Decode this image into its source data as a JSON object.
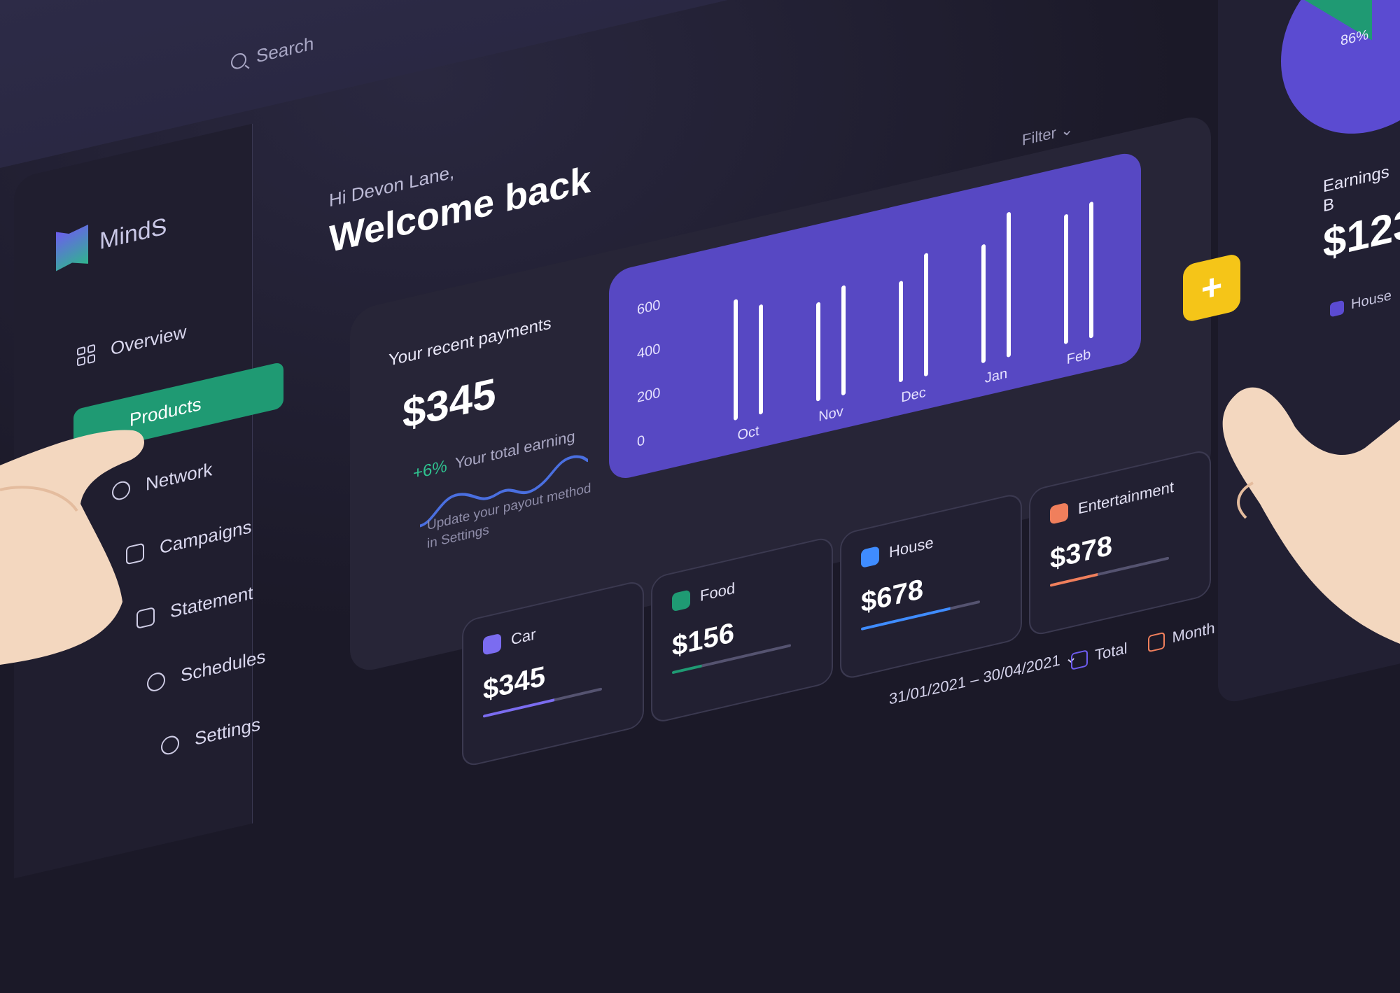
{
  "search": {
    "label": "Search"
  },
  "brand": {
    "name": "MindS"
  },
  "nav": [
    {
      "label": "Overview",
      "icon": "grid-icon"
    },
    {
      "label": "Products",
      "icon": "box-icon",
      "active": true
    },
    {
      "label": "Network",
      "icon": "users-icon"
    },
    {
      "label": "Campaigns",
      "icon": "chart-icon"
    },
    {
      "label": "Statement",
      "icon": "document-icon"
    },
    {
      "label": "Schedules",
      "icon": "compass-icon"
    },
    {
      "label": "Settings",
      "icon": "gear-icon"
    }
  ],
  "greeting": {
    "hi": "Hi Devon Lane,",
    "title": "Welcome back"
  },
  "payments": {
    "label": "Your recent payments",
    "value": "$345",
    "change": "+6%",
    "change_label": "Your total earning",
    "hint": "Update your payout method in Settings"
  },
  "filter": {
    "label": "Filter"
  },
  "categories": [
    {
      "name": "Car",
      "value": "$345",
      "color": "#7b6cf0"
    },
    {
      "name": "Food",
      "value": "$156",
      "color": "#1f9a73"
    },
    {
      "name": "House",
      "value": "$678",
      "color": "#3f8cff"
    },
    {
      "name": "Entertainment",
      "value": "$378",
      "color": "#f07f5c"
    }
  ],
  "date_range": {
    "label": "31/01/2021 – 30/04/2021"
  },
  "legend": {
    "total": "Total",
    "month": "Month"
  },
  "right_panel": {
    "pie_pct": "86%",
    "earnings_label": "Earnings B",
    "earnings_value": "$123",
    "legend_house": "House"
  },
  "fab": {
    "label": "+"
  },
  "colors": {
    "accent_green": "#1f9a73",
    "accent_purple": "#5748c3",
    "fab_yellow": "#f5c518"
  },
  "chart_data": {
    "type": "bar",
    "categories": [
      "Oct",
      "Nov",
      "Dec",
      "Jan",
      "Feb"
    ],
    "series": [
      {
        "values": [
          530,
          430,
          440,
          520,
          570
        ]
      },
      {
        "values": [
          480,
          480,
          540,
          640,
          600
        ]
      }
    ],
    "yticks": [
      0,
      200,
      400,
      600
    ],
    "ylim": [
      0,
      700
    ],
    "grid": false
  }
}
